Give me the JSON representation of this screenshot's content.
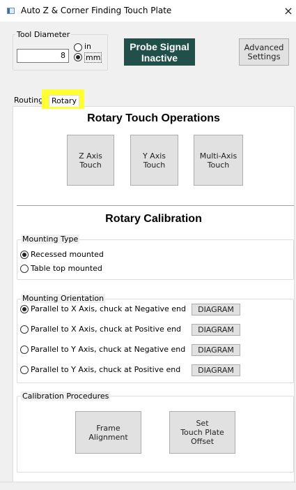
{
  "window": {
    "title": "Auto Z & Corner Finding Touch Plate",
    "close_icon": "×"
  },
  "tool_diameter": {
    "label": "Tool Diameter",
    "value": "8",
    "units": [
      {
        "label": "in",
        "checked": false
      },
      {
        "label": "mm",
        "checked": true
      }
    ]
  },
  "probe_signal": {
    "text": "Probe Signal\nInactive",
    "color": "#21504a"
  },
  "advanced_settings_label": "Advanced\nSettings",
  "tabs": [
    {
      "label": "Routing",
      "active": false
    },
    {
      "label": "Rotary",
      "active": true,
      "highlight": "#ffff33"
    }
  ],
  "rotary_touch": {
    "heading": "Rotary Touch Operations",
    "buttons": [
      "Z Axis\nTouch",
      "Y Axis\nTouch",
      "Multi-Axis\nTouch"
    ]
  },
  "rotary_calibration": {
    "heading": "Rotary Calibration",
    "mounting_type": {
      "label": "Mounting Type",
      "options": [
        {
          "label": "Recessed mounted",
          "checked": true
        },
        {
          "label": "Table top mounted",
          "checked": false
        }
      ]
    },
    "mounting_orientation": {
      "label": "Mounting Orientation",
      "diagram_label": "DIAGRAM",
      "options": [
        {
          "label": "Parallel to X Axis, chuck at Negative end",
          "checked": true
        },
        {
          "label": "Parallel to X Axis, chuck at Positive end",
          "checked": false
        },
        {
          "label": "Parallel to Y Axis, chuck at Negative end",
          "checked": false
        },
        {
          "label": "Parallel to Y Axis, chuck at Positive end",
          "checked": false
        }
      ]
    },
    "calibration_procedures": {
      "label": "Calibration Procedures",
      "buttons": [
        "Frame\nAlignment",
        "Set\nTouch Plate\nOffset"
      ]
    }
  }
}
